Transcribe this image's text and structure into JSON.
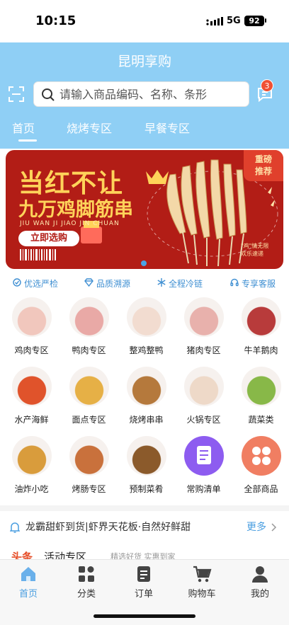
{
  "status": {
    "time": "10:15",
    "network": "5G",
    "battery": "92"
  },
  "app": {
    "title": "昆明享购"
  },
  "search": {
    "placeholder": "请输入商品编码、名称、条形"
  },
  "messages": {
    "badge": "3"
  },
  "tabs": [
    {
      "label": "首页",
      "active": true
    },
    {
      "label": "烧烤专区",
      "active": false
    },
    {
      "label": "早餐专区",
      "active": false
    }
  ],
  "banner": {
    "title_line1": "当红不让",
    "title_line2": "九万鸡脚筋串",
    "pinyin": "JIU WAN JI JIAO JIN CHUAN",
    "button": "立即选购",
    "tag_line1": "重磅",
    "tag_line2": "推荐",
    "note_line1": "\"鸡\"情无限",
    "note_line2": "欢乐速递"
  },
  "features": [
    {
      "label": "优选严检",
      "icon": "check-circle-icon"
    },
    {
      "label": "品质溯源",
      "icon": "diamond-icon"
    },
    {
      "label": "全程冷链",
      "icon": "snowflake-icon"
    },
    {
      "label": "专享客服",
      "icon": "headset-icon"
    }
  ],
  "categories": [
    {
      "label": "鸡肉专区",
      "icon": "chicken-meat-icon",
      "color": "#f1c7bd"
    },
    {
      "label": "鸭肉专区",
      "icon": "duck-meat-icon",
      "color": "#e9a9a6"
    },
    {
      "label": "整鸡整鸭",
      "icon": "whole-chicken-icon",
      "color": "#f2dcd0"
    },
    {
      "label": "猪肉专区",
      "icon": "pork-icon",
      "color": "#e8b1ac"
    },
    {
      "label": "牛羊鹅肉",
      "icon": "beef-icon",
      "color": "#b83b3b"
    },
    {
      "label": "水产海鲜",
      "icon": "seafood-icon",
      "color": "#e0532b"
    },
    {
      "label": "面点专区",
      "icon": "pastry-icon",
      "color": "#e6b046"
    },
    {
      "label": "烧烤串串",
      "icon": "skewer-icon",
      "color": "#b5793c"
    },
    {
      "label": "火锅专区",
      "icon": "hotpot-icon",
      "color": "#eed9c8"
    },
    {
      "label": "蔬菜类",
      "icon": "vegetable-icon",
      "color": "#88b848"
    },
    {
      "label": "油炸小吃",
      "icon": "fried-snack-icon",
      "color": "#d99c3c"
    },
    {
      "label": "烤肠专区",
      "icon": "sausage-icon",
      "color": "#c9713c"
    },
    {
      "label": "预制菜肴",
      "icon": "prepared-dish-icon",
      "color": "#8b5a2b"
    },
    {
      "label": "常购清单",
      "icon": "list-icon",
      "color": "#8d5cf0"
    },
    {
      "label": "全部商品",
      "icon": "all-products-icon",
      "color": "#f07e62"
    }
  ],
  "notice": {
    "text": "龙霸甜虾到货|虾界天花板·自然好鲜甜",
    "more": "更多"
  },
  "promo": {
    "tag": "头条",
    "title": "活动专区",
    "subtitle": "精选好货 实惠到家"
  },
  "tabbar": [
    {
      "label": "首页",
      "icon": "home-icon",
      "active": true
    },
    {
      "label": "分类",
      "icon": "category-icon",
      "active": false
    },
    {
      "label": "订单",
      "icon": "order-icon",
      "active": false
    },
    {
      "label": "购物车",
      "icon": "cart-icon",
      "active": false
    },
    {
      "label": "我的",
      "icon": "profile-icon",
      "active": false
    }
  ],
  "colors": {
    "header": "#8fcff5",
    "accent": "#4a9ee0",
    "banner": "#b21d16"
  }
}
